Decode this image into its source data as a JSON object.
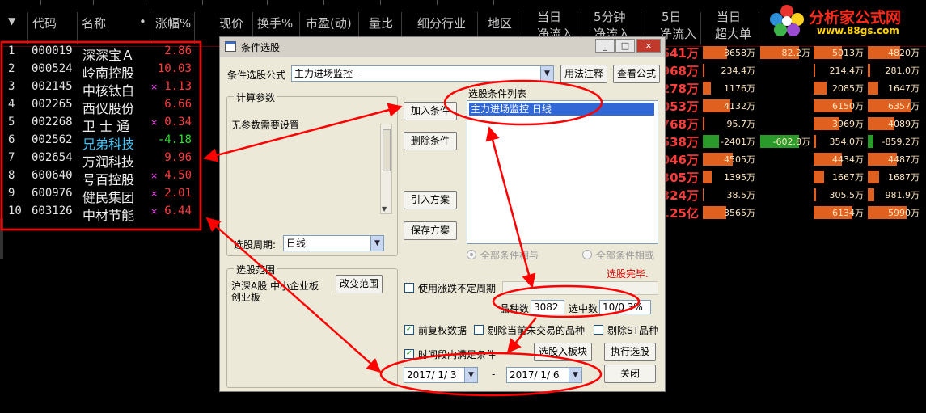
{
  "columns": {
    "menu": "▼",
    "code": "代码",
    "name": "名称",
    "dot": "•",
    "change": "涨幅%",
    "price": "现价",
    "turnover": "换手%",
    "pe": "市盈(动)",
    "volratio": "量比",
    "industry": "细分行业",
    "region": "地区",
    "day_inflow_1": "当日",
    "day_inflow_2": "净流入",
    "min5_1": "5分钟",
    "min5_2": "净流入",
    "day5_1": "5日",
    "day5_2": "净流入",
    "dayxl_1": "当日",
    "dayxl_2": "超大单"
  },
  "rows": [
    {
      "no": "1",
      "code": "000019",
      "name": "深深宝Ａ",
      "mark": "",
      "change": "2.86",
      "change_color": "red",
      "right": "541万",
      "b1": "3658万",
      "b1_frac": 0.45,
      "b2": "82.2万",
      "b2_frac": 0.75,
      "b3": "5013万",
      "b3_frac": 0.55,
      "b4": "4820万",
      "b4_frac": 0.6
    },
    {
      "no": "2",
      "code": "000524",
      "name": "岭南控股",
      "mark": "",
      "change": "10.03",
      "change_color": "red",
      "right": "968万",
      "b1": "234.4万",
      "b1_frac": 0.03,
      "b2": "",
      "b2_frac": 0,
      "b3": "214.4万",
      "b3_frac": 0.03,
      "b4": "281.0万",
      "b4_frac": 0.04
    },
    {
      "no": "3",
      "code": "002145",
      "name": "中核钛白",
      "mark": "×",
      "change": "1.13",
      "change_color": "red",
      "right": "278万",
      "b1": "1176万",
      "b1_frac": 0.15,
      "b2": "",
      "b2_frac": 0,
      "b3": "2085万",
      "b3_frac": 0.25,
      "b4": "1647万",
      "b4_frac": 0.2
    },
    {
      "no": "4",
      "code": "002265",
      "name": "西仪股份",
      "mark": "",
      "change": "6.66",
      "change_color": "red",
      "right": "053万",
      "b1": "4132万",
      "b1_frac": 0.5,
      "b2": "",
      "b2_frac": 0,
      "b3": "6150万",
      "b3_frac": 0.75,
      "b4": "6357万",
      "b4_frac": 0.8
    },
    {
      "no": "5",
      "code": "002268",
      "name": "卫 士 通",
      "mark": "×",
      "change": "0.34",
      "change_color": "red",
      "right": "768万",
      "b1": "95.7万",
      "b1_frac": 0.03,
      "b2": "",
      "b2_frac": 0,
      "b3": "3969万",
      "b3_frac": 0.5,
      "b4": "4089万",
      "b4_frac": 0.5
    },
    {
      "no": "6",
      "code": "002562",
      "name": "兄弟科技",
      "mark": "",
      "change": "-4.18",
      "change_color": "green",
      "right": "538万",
      "b1": "-2401万",
      "b1_frac": 0.3,
      "b2": "-602.8万",
      "b2_frac": 0.75,
      "b3": "354.0万",
      "b3_frac": 0.04,
      "b4": "-859.2万",
      "b4_frac": 0.1
    },
    {
      "no": "7",
      "code": "002654",
      "name": "万润科技",
      "mark": "",
      "change": "9.96",
      "change_color": "red",
      "right": "046万",
      "b1": "4505万",
      "b1_frac": 0.55,
      "b2": "",
      "b2_frac": 0,
      "b3": "4434万",
      "b3_frac": 0.55,
      "b4": "4487万",
      "b4_frac": 0.55
    },
    {
      "no": "8",
      "code": "600640",
      "name": "号百控股",
      "mark": "×",
      "change": "4.50",
      "change_color": "red",
      "right": "305万",
      "b1": "1395万",
      "b1_frac": 0.17,
      "b2": "",
      "b2_frac": 0,
      "b3": "1667万",
      "b3_frac": 0.2,
      "b4": "1687万",
      "b4_frac": 0.21
    },
    {
      "no": "9",
      "code": "600976",
      "name": "健民集团",
      "mark": "×",
      "change": "2.01",
      "change_color": "red",
      "right": "324万",
      "b1": "38.5万",
      "b1_frac": 0.02,
      "b2": "",
      "b2_frac": 0,
      "b3": "305.5万",
      "b3_frac": 0.04,
      "b4": "981.9万",
      "b4_frac": 0.12
    },
    {
      "no": "10",
      "code": "603126",
      "name": "中材节能",
      "mark": "×",
      "change": "6.44",
      "change_color": "red",
      "right": ".25亿",
      "b1": "3565万",
      "b1_frac": 0.43,
      "b2": "",
      "b2_frac": 0,
      "b3": "6134万",
      "b3_frac": 0.75,
      "b4": "5990万",
      "b4_frac": 0.73
    }
  ],
  "logo": {
    "title": "分析家公式网",
    "url": "www.88gs.com"
  },
  "dialog": {
    "title": "条件选股",
    "min_btn": "_",
    "max_btn": "□",
    "close_btn": "×",
    "formula_label": "条件选股公式",
    "formula_value": "主力进场监控 -",
    "usage_btn": "用法注释",
    "view_btn": "查看公式",
    "params_group": "计算参数",
    "params_text": "无参数需要设置",
    "period_label": "选股周期:",
    "period_value": "日线",
    "add_btn": "加入条件",
    "delete_btn": "删除条件",
    "import_btn": "引入方案",
    "save_btn": "保存方案",
    "list_label": "选股条件列表",
    "list_item": "主力进场监控  日线",
    "radio_and": "全部条件相与",
    "radio_or": "全部条件相或",
    "status": "选股完毕.",
    "range_group": "选股范围",
    "range_text_1": "沪深A股 中小企业板",
    "range_text_2": "创业板",
    "change_range_btn": "改变范围",
    "irregular_label": "使用涨跌不定周期",
    "count_label": "品种数",
    "count_value": "3082",
    "selected_label": "选中数",
    "selected_value": "10/0.3%",
    "adjust_label": "前复权数据",
    "exclude_label": "剔除当前未交易的品种",
    "exclude_st_label": "剔除ST品种",
    "time_label": "时间段内满足条件",
    "to_block_btn": "选股入板块",
    "run_btn": "执行选股",
    "date_from": "2017/ 1/ 3",
    "date_sep": "-",
    "date_to": "2017/ 1/ 6",
    "close_dlg_btn": "关闭"
  },
  "colors": {
    "up": "#ff3c3c",
    "down": "#33dd33",
    "annot": "#ff0000",
    "bar": "#e06020"
  }
}
